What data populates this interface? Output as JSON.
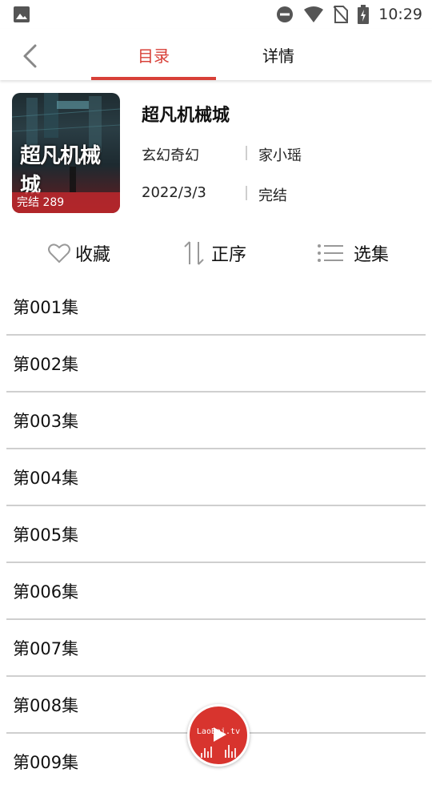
{
  "status_bar": {
    "time": "10:29",
    "icons": [
      "image-icon",
      "do-not-disturb-icon",
      "wifi-icon",
      "no-sim-icon",
      "battery-charging-icon"
    ]
  },
  "header": {
    "tabs": [
      {
        "label": "目录",
        "active": true
      },
      {
        "label": "详情",
        "active": false
      }
    ],
    "accent_color": "#d84038"
  },
  "book": {
    "cover_title": "超凡机械城",
    "cover_badge": "完结 289",
    "title": "超凡机械城",
    "genre": "玄幻奇幻",
    "author": "家小瑶",
    "date": "2022/3/3",
    "status": "完结"
  },
  "actions": {
    "favorite_label": "收藏",
    "order_label": "正序",
    "select_label": "选集"
  },
  "episodes": [
    {
      "label": "第001集"
    },
    {
      "label": "第002集"
    },
    {
      "label": "第003集"
    },
    {
      "label": "第004集"
    },
    {
      "label": "第005集"
    },
    {
      "label": "第006集"
    },
    {
      "label": "第007集"
    },
    {
      "label": "第008集"
    },
    {
      "label": "第009集"
    }
  ],
  "player": {
    "text": "LaoBai.tv",
    "color": "#d8342e"
  }
}
